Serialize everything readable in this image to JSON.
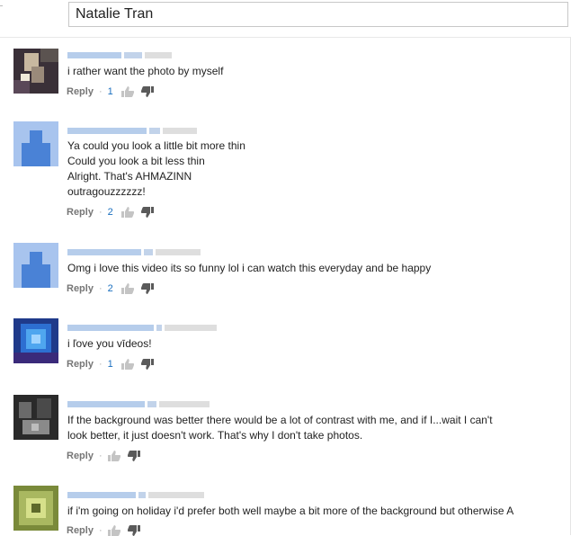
{
  "search": {
    "value": "Natalie Tran"
  },
  "ui": {
    "reply_label": "Reply",
    "separator": "·"
  },
  "comments": [
    {
      "text": [
        "i rather want the photo by myself"
      ],
      "likes": "1"
    },
    {
      "text": [
        "Ya could you look a little bit more thin",
        "Could you look a bit less thin",
        "Alright. That's AHMAZINN",
        "outragouzzzzzz!"
      ],
      "likes": "2"
    },
    {
      "text": [
        "Omg i love this video its so funny lol i can watch this everyday and be happy"
      ],
      "likes": "2"
    },
    {
      "text": [
        "i ľove you vīdeos!"
      ],
      "likes": "1"
    },
    {
      "text": [
        "If the background was better there would be a lot of contrast with me, and if I...wait I can't",
        "look better, it just doesn't work. That's why I don't take photos."
      ],
      "likes": ""
    },
    {
      "text": [
        "if i'm going on holiday i'd prefer both well maybe a bit more of the background but otherwise A"
      ],
      "likes": ""
    }
  ],
  "colors": {
    "link": "#1a6fbf",
    "meta": "#767676",
    "text": "#222222",
    "placeholder_avatar": "#6b9be0"
  },
  "icons": {
    "like": "thumbs-up-icon",
    "dislike": "thumbs-down-icon"
  }
}
